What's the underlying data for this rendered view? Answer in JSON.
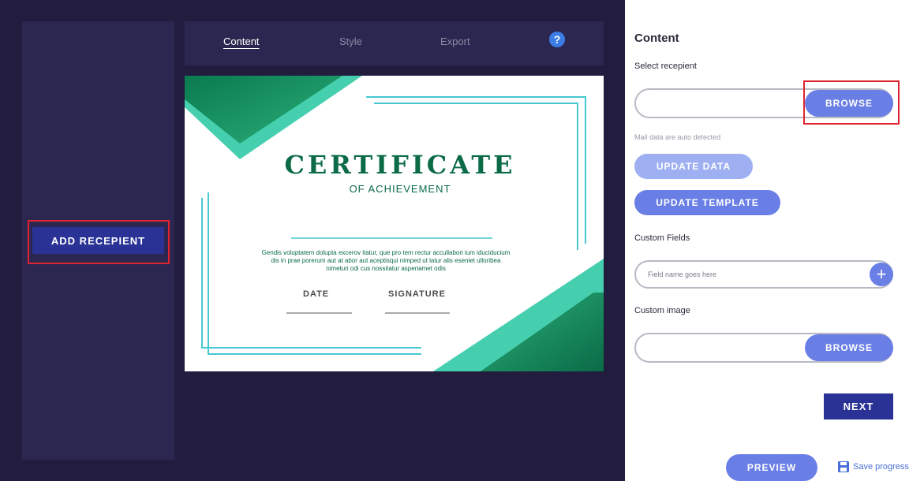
{
  "sidebar": {
    "add_recipient_label": "ADD RECEPIENT"
  },
  "tabs": [
    {
      "label": "Content",
      "active": true
    },
    {
      "label": "Style",
      "active": false
    },
    {
      "label": "Export",
      "active": false
    }
  ],
  "help_icon": "?",
  "certificate": {
    "title": "CERTIFICATE",
    "subtitle": "OF ACHIEVEMENT",
    "body": "Gendis voluptatem dolupta excerov itatur, que pro tem rectur accullabori ium iduciducium dis in prae porerum aut at abor aut aceptisqui nimped ut latur alis eseniet ulloribea nimeturi odi cus nossitatur asperiamet odis",
    "date_label": "DATE",
    "signature_label": "SIGNATURE"
  },
  "panel": {
    "title": "Content",
    "select_recipient_label": "Select recepient",
    "browse_label": "BROWSE",
    "hint": "Mail data are auto detected",
    "update_data_label": "UPDATE DATA",
    "update_template_label": "UPDATE TEMPLATE",
    "custom_fields_label": "Custom Fields",
    "field_placeholder": "Field name goes here",
    "add_field_icon": "+",
    "custom_image_label": "Custom image",
    "browse_image_label": "BROWSE",
    "next_label": "NEXT",
    "preview_label": "PREVIEW",
    "save_progress_label": "Save progress"
  },
  "colors": {
    "dark_bg": "#221c3e",
    "panel_bg": "#2c2750",
    "primary_button": "#2a3296",
    "pill_button": "#6a7fe6",
    "highlight": "#e0242f",
    "cert_green": "#0a6b46",
    "cert_teal": "#46cfae"
  }
}
